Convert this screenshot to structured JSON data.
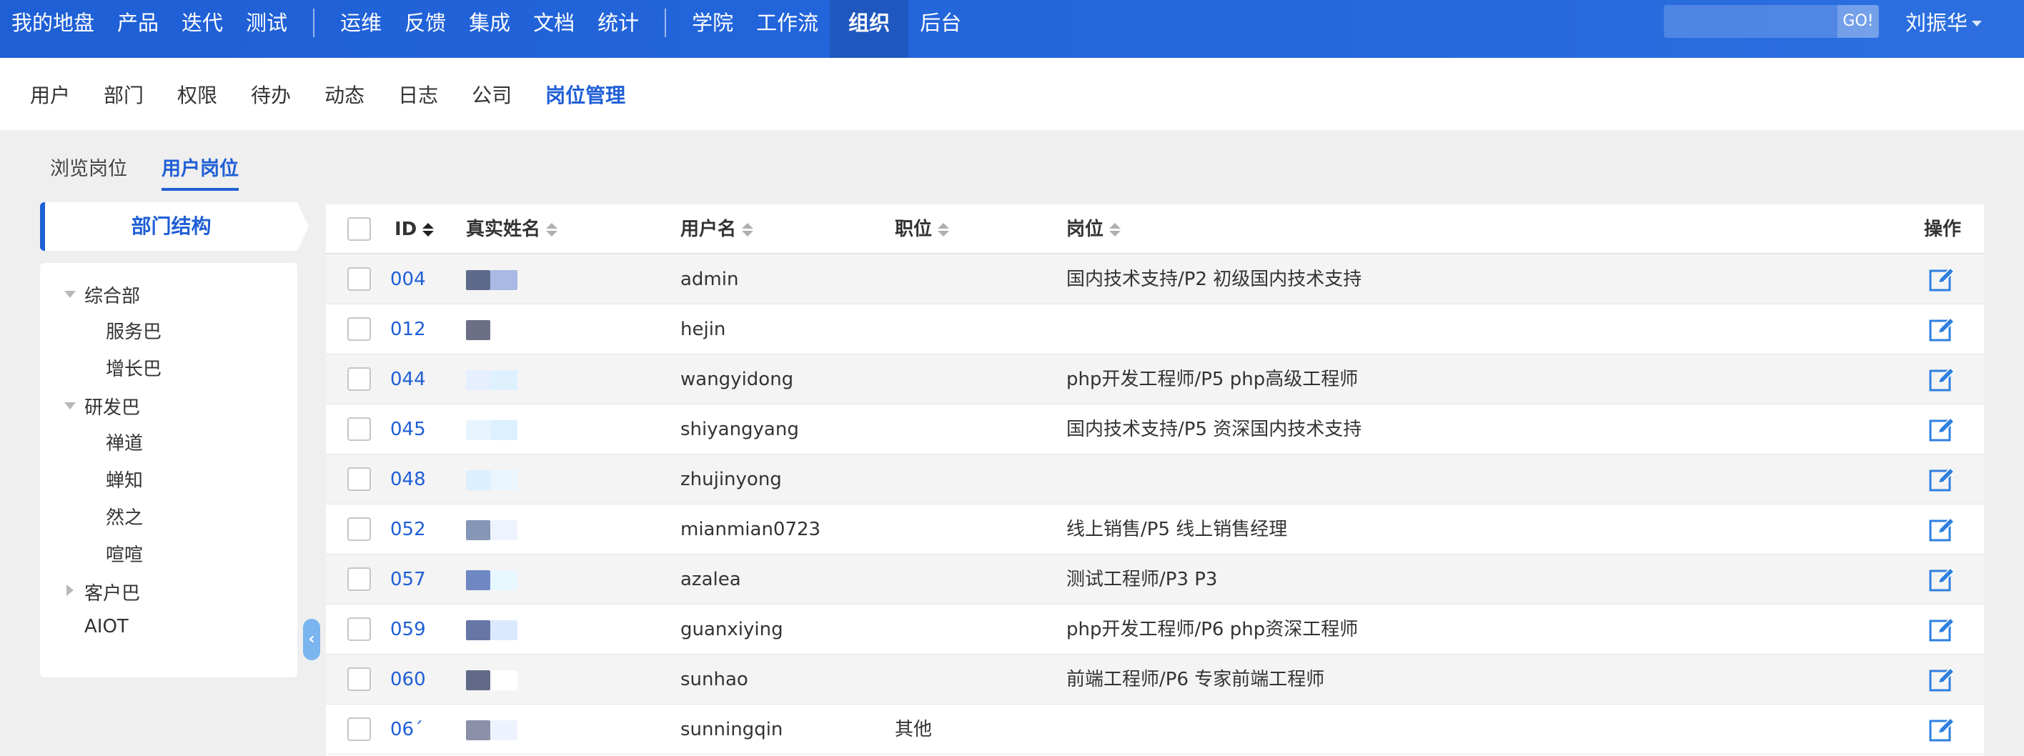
{
  "topnav": {
    "items": [
      "我的地盘",
      "产品",
      "迭代",
      "测试",
      "运维",
      "反馈",
      "集成",
      "文档",
      "统计",
      "学院",
      "工作流",
      "组织",
      "后台"
    ],
    "active": "组织",
    "search_placeholder": "",
    "go_label": "GO!",
    "user_name": "刘振华"
  },
  "subnav": {
    "items": [
      "用户",
      "部门",
      "权限",
      "待办",
      "动态",
      "日志",
      "公司",
      "岗位管理"
    ],
    "active": "岗位管理"
  },
  "tabs": {
    "items": [
      "浏览岗位",
      "用户岗位"
    ],
    "active": "用户岗位"
  },
  "tree": {
    "header": "部门结构",
    "nodes": [
      "综合部",
      "服务巴",
      "增长巴",
      "研发巴",
      "禅道",
      "蝉知",
      "然之",
      "喧喧",
      "客户巴",
      "AIOT"
    ]
  },
  "table": {
    "columns": {
      "id": "ID",
      "realname": "真实姓名",
      "username": "用户名",
      "role": "职位",
      "position": "岗位",
      "actions": "操作"
    },
    "rows": [
      {
        "id": "004",
        "username": "admin",
        "role": "",
        "position": "国内技术支持/P2 初级国内技术支持"
      },
      {
        "id": "012",
        "username": "hejin",
        "role": "",
        "position": ""
      },
      {
        "id": "044",
        "username": "wangyidong",
        "role": "",
        "position": "php开发工程师/P5 php高级工程师"
      },
      {
        "id": "045",
        "username": "shiyangyang",
        "role": "",
        "position": "国内技术支持/P5 资深国内技术支持"
      },
      {
        "id": "048",
        "username": "zhujinyong",
        "role": "",
        "position": ""
      },
      {
        "id": "052",
        "username": "mianmian0723",
        "role": "",
        "position": "线上销售/P5 线上销售经理"
      },
      {
        "id": "057",
        "username": "azalea",
        "role": "",
        "position": "测试工程师/P3 P3"
      },
      {
        "id": "059",
        "username": "guanxiying",
        "role": "",
        "position": "php开发工程师/P6 php资深工程师"
      },
      {
        "id": "060",
        "username": "sunhao",
        "role": "",
        "position": "前端工程师/P6 专家前端工程师"
      },
      {
        "id": "06´",
        "username": "sunningqin",
        "role": "其他",
        "position": ""
      }
    ]
  },
  "colors": {
    "brand": "#1f5fd6",
    "edit_icon": "#2f7fe0"
  }
}
